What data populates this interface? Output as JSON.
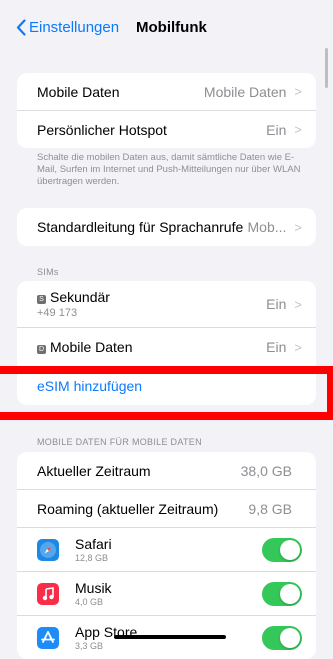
{
  "nav": {
    "back_label": "Einstellungen",
    "title": "Mobilfunk"
  },
  "group1": [
    {
      "label": "Mobile Daten",
      "value": "Mobile Daten"
    },
    {
      "label": "Persönlicher Hotspot",
      "value": "Ein"
    }
  ],
  "group1_note": "Schalte die mobilen Daten aus, damit sämtliche Daten wie E-Mail, Surfen im Internet und Push-Mitteilungen nur über WLAN übertragen werden.",
  "voice": {
    "label": "Standardleitung für Sprachanrufe",
    "value": "Mob..."
  },
  "sims": {
    "header": "SIMs",
    "items": [
      {
        "badge": "S",
        "label": "Sekundär",
        "number": "+49 173",
        "value": "Ein"
      },
      {
        "badge": "D",
        "label": "Mobile Daten",
        "value": "Ein"
      }
    ],
    "add_label": "eSIM hinzufügen"
  },
  "usage": {
    "header": "MOBILE DATEN FÜR MOBILE DATEN",
    "current": {
      "label": "Aktueller Zeitraum",
      "value": "38,0 GB"
    },
    "roaming": {
      "label": "Roaming (aktueller Zeitraum)",
      "value": "9,8 GB"
    },
    "apps": [
      {
        "name": "Safari",
        "size": "12,8 GB",
        "icon": "safari-icon",
        "color": "#1e88e5",
        "enabled": true
      },
      {
        "name": "Musik",
        "size": "4,0 GB",
        "icon": "music-icon",
        "color": "#fa2d48",
        "enabled": true
      },
      {
        "name": "App Store",
        "size": "3,3 GB",
        "icon": "app-store-icon",
        "color": "#1d8cf8",
        "enabled": true
      }
    ]
  },
  "colors": {
    "accent": "#0a7aff",
    "toggle_on": "#34c759",
    "highlight": "#ff0000"
  }
}
